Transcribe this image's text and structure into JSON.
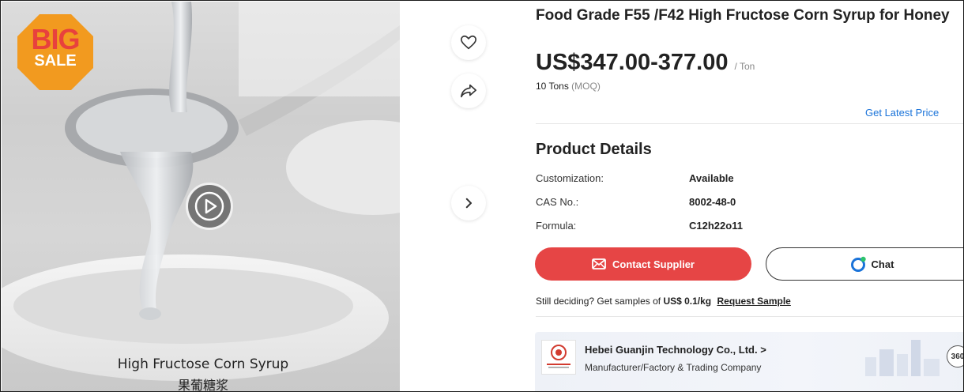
{
  "media": {
    "badge": {
      "line1": "BIG",
      "line2": "SALE"
    },
    "caption_en": "High Fructose Corn Syrup",
    "caption_zh": "果葡糖浆",
    "play_icon": "play-icon"
  },
  "actions": {
    "favorite_icon": "heart-icon",
    "share_icon": "share-icon",
    "next_icon": "chevron-right-icon"
  },
  "product": {
    "title": "Food Grade F55 /F42 High Fructose Corn Syrup for Honey",
    "price": "US$347.00-377.00",
    "price_unit": "/ Ton",
    "moq_value": "10 Tons",
    "moq_tag": "(MOQ)",
    "latest_price_link": "Get Latest Price"
  },
  "details": {
    "heading": "Product Details",
    "specs": [
      {
        "label": "Customization:",
        "value": "Available"
      },
      {
        "label": "CAS No.:",
        "value": "8002-48-0"
      },
      {
        "label": "Formula:",
        "value": "C12h22o11"
      }
    ]
  },
  "buttons": {
    "contact_label": "Contact Supplier",
    "chat_label": "Chat"
  },
  "samples": {
    "prefix": "Still deciding? Get samples of",
    "price": "US$ 0.1/kg",
    "link": "Request Sample"
  },
  "supplier": {
    "name": "Hebei Guanjin Technology Co., Ltd.",
    "name_arrow": ">",
    "type": "Manufacturer/Factory & Trading Company",
    "view360_label": "360"
  },
  "colors": {
    "accent_red": "#e64545",
    "link_blue": "#1a73d9",
    "badge_orange": "#f29a1f"
  }
}
